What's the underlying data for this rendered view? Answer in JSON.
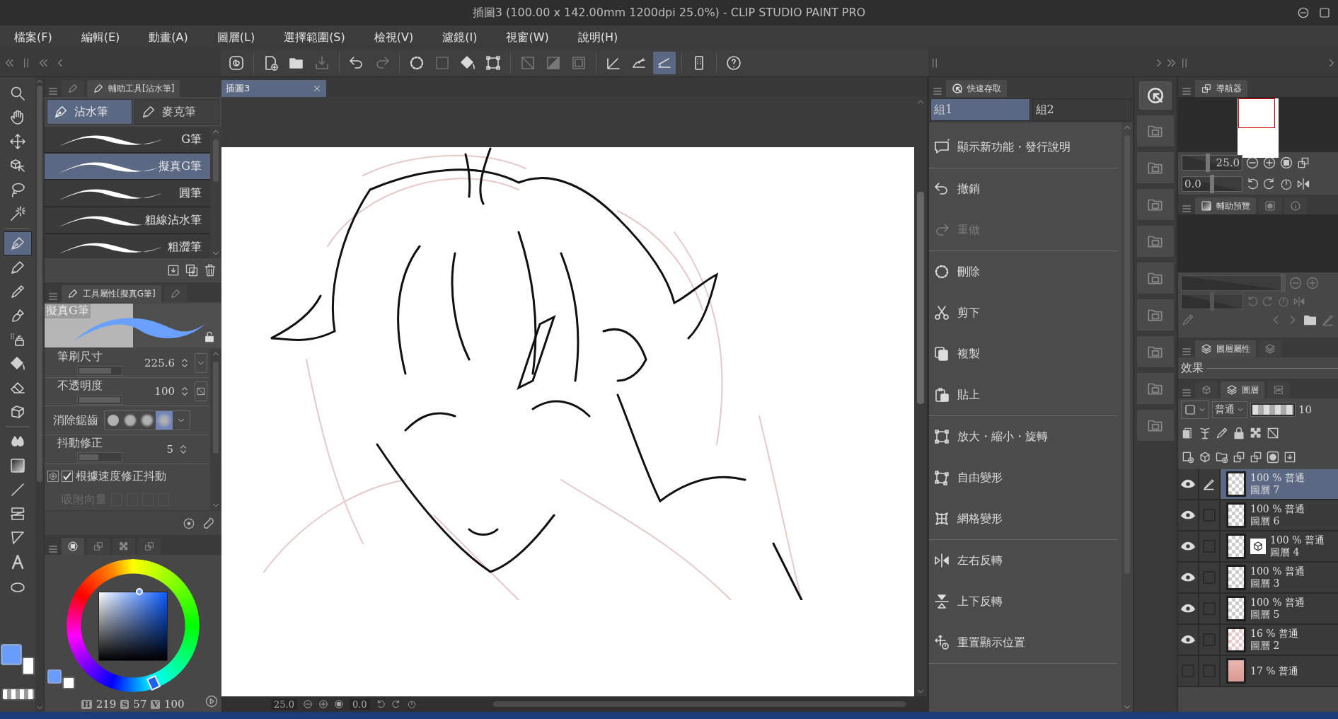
{
  "window": {
    "title": "插圖3 (100.00 x 142.00mm 1200dpi 25.0%)  - CLIP STUDIO PAINT PRO"
  },
  "menu": [
    "檔案(F)",
    "編輯(E)",
    "動畫(A)",
    "圖層(L)",
    "選擇範圍(S)",
    "檢視(V)",
    "濾鏡(I)",
    "視窗(W)",
    "說明(H)"
  ],
  "toolbar": [
    {
      "kind": "logo",
      "selected": false,
      "disabled": false
    },
    {
      "kind": "new",
      "selected": false,
      "disabled": false
    },
    {
      "kind": "open",
      "selected": false,
      "disabled": false
    },
    {
      "kind": "export",
      "selected": false,
      "disabled": true
    },
    {
      "kind": "undo",
      "selected": false,
      "disabled": false
    },
    {
      "kind": "redo",
      "selected": false,
      "disabled": true
    },
    {
      "kind": "clear",
      "selected": false,
      "disabled": false
    },
    {
      "kind": "dashed",
      "selected": false,
      "disabled": true
    },
    {
      "kind": "fill",
      "selected": false,
      "disabled": false
    },
    {
      "kind": "transform",
      "selected": false,
      "disabled": false
    },
    {
      "kind": "crossed",
      "selected": false,
      "disabled": true
    },
    {
      "kind": "half",
      "selected": false,
      "disabled": true
    },
    {
      "kind": "inset",
      "selected": false,
      "disabled": true
    },
    {
      "kind": "angle-ruler",
      "selected": false,
      "disabled": false
    },
    {
      "kind": "curve-ruler",
      "selected": false,
      "disabled": false
    },
    {
      "kind": "ruler",
      "selected": true,
      "disabled": false
    },
    {
      "kind": "tablet",
      "selected": false,
      "disabled": false
    },
    {
      "kind": "help",
      "selected": false,
      "disabled": false
    }
  ],
  "tools": [
    {
      "kind": "zoom",
      "selected": false
    },
    {
      "kind": "hand",
      "selected": false
    },
    {
      "kind": "move",
      "selected": false
    },
    {
      "kind": "object",
      "selected": false
    },
    {
      "kind": "lasso",
      "selected": false
    },
    {
      "kind": "wand",
      "selected": false
    },
    {
      "kind": "pen",
      "selected": true
    },
    {
      "kind": "marker",
      "selected": false
    },
    {
      "kind": "dropper",
      "selected": false
    },
    {
      "kind": "brush",
      "selected": false
    },
    {
      "kind": "spray",
      "selected": false
    },
    {
      "kind": "fill",
      "selected": false
    },
    {
      "kind": "eraser",
      "selected": false
    },
    {
      "kind": "block",
      "selected": false
    },
    {
      "kind": "drops",
      "selected": false
    },
    {
      "kind": "gradient",
      "selected": false
    },
    {
      "kind": "line",
      "selected": false
    },
    {
      "kind": "frame",
      "selected": false
    },
    {
      "kind": "triangle",
      "selected": false
    },
    {
      "kind": "text",
      "selected": false
    },
    {
      "kind": "ellipse",
      "selected": false
    }
  ],
  "subtool_panel": {
    "title": "輔助工具[沾水筆]",
    "groups": [
      {
        "label": "沾水筆",
        "selected": true
      },
      {
        "label": "麥克筆",
        "selected": false
      }
    ],
    "brushes": [
      {
        "name": "G筆",
        "selected": false
      },
      {
        "name": "擬真G筆",
        "selected": true
      },
      {
        "name": "圓筆",
        "selected": false
      },
      {
        "name": "粗線沾水筆",
        "selected": false
      },
      {
        "name": "粗澀筆",
        "selected": false
      }
    ]
  },
  "tool_property": {
    "title": "工具屬性[擬真G筆]",
    "preview_label": "擬真G筆",
    "brush_size": {
      "label": "筆刷尺寸",
      "value": "225.6",
      "level": 0.78
    },
    "opacity": {
      "label": "不透明度",
      "value": "100",
      "level": 1
    },
    "anti_aliasing": {
      "label": "消除鋸齒",
      "options": [
        {
          "selected": false
        },
        {
          "selected": false
        },
        {
          "selected": false
        },
        {
          "selected": true
        }
      ]
    },
    "stabilization": {
      "label": "抖動修正",
      "value": "5",
      "level": 0.47
    },
    "speed_correction": {
      "label": "根據速度修正抖動",
      "checked": true
    },
    "vector_snap": {
      "label": "吸附向量",
      "disabled": true
    }
  },
  "color": {
    "hsv": [
      {
        "label": "H",
        "value": "219"
      },
      {
        "label": "S",
        "value": "57"
      },
      {
        "label": "V",
        "value": "100"
      }
    ]
  },
  "canvas": {
    "tab": "插圖3",
    "zoom": "25.0",
    "rotation": "0.0"
  },
  "quick_access": {
    "title": "快速存取",
    "groups": [
      {
        "label": "組1",
        "selected": true
      },
      {
        "label": "組2",
        "selected": false
      }
    ],
    "sections": [
      {
        "items": [
          {
            "kind": "news",
            "label": "顯示新功能・發行說明",
            "disabled": false
          }
        ]
      },
      {
        "items": [
          {
            "kind": "undo",
            "label": "撤銷",
            "disabled": false
          },
          {
            "kind": "redo",
            "label": "重做",
            "disabled": true
          }
        ]
      },
      {
        "items": [
          {
            "kind": "clear",
            "label": "刪除",
            "disabled": false
          },
          {
            "kind": "cut",
            "label": "剪下",
            "disabled": false
          },
          {
            "kind": "copy",
            "label": "複製",
            "disabled": false
          },
          {
            "kind": "paste",
            "label": "貼上",
            "disabled": false
          }
        ]
      },
      {
        "items": [
          {
            "kind": "transform",
            "label": "放大・縮小・旋轉",
            "disabled": false
          },
          {
            "kind": "free-transform",
            "label": "自由變形",
            "disabled": false
          },
          {
            "kind": "mesh",
            "label": "網格變形",
            "disabled": false
          }
        ]
      },
      {
        "items": [
          {
            "kind": "flip-h",
            "label": "左右反轉",
            "disabled": false
          },
          {
            "kind": "flip-v",
            "label": "上下反轉",
            "disabled": false
          },
          {
            "kind": "reset",
            "label": "重置顯示位置",
            "disabled": false
          }
        ]
      }
    ]
  },
  "navigator": {
    "title": "導航器",
    "zoom": {
      "value": "25.0",
      "level": 0.42
    },
    "rotation": {
      "value": "0.0",
      "level": 0.5
    }
  },
  "sub_view": {
    "title": "輔助預覽",
    "zoom": {
      "level": 1
    },
    "rotation": {
      "level": 0.5
    }
  },
  "layer_property": {
    "title": "圖層屬性",
    "effect_label": "效果"
  },
  "layers": {
    "title": "圖層",
    "blend_mode": "普通",
    "opacity": "10",
    "opacity_slider": {
      "level": 1
    },
    "items": [
      {
        "kind": "raster",
        "opacity_mode": "100 % 普通",
        "name": "圖層 7",
        "visible": true,
        "editing": true,
        "selected": true
      },
      {
        "kind": "raster",
        "opacity_mode": "100 % 普通",
        "name": "圖層 6",
        "visible": true,
        "editing": false,
        "selected": false
      },
      {
        "kind": "model",
        "opacity_mode": "100 % 普通",
        "name": "圖層 4",
        "visible": true,
        "editing": false,
        "selected": false
      },
      {
        "kind": "raster",
        "opacity_mode": "100 % 普通",
        "name": "圖層 3",
        "visible": true,
        "editing": false,
        "selected": false
      },
      {
        "kind": "raster",
        "opacity_mode": "100 % 普通",
        "name": "圖層 5",
        "visible": true,
        "editing": false,
        "selected": false
      },
      {
        "kind": "sketch",
        "opacity_mode": "16 % 普通",
        "name": "圖層 2",
        "visible": true,
        "editing": false,
        "selected": false
      },
      {
        "kind": "photo",
        "opacity_mode": "17 % 普通",
        "visible": false,
        "editing": false,
        "selected": false
      }
    ]
  }
}
